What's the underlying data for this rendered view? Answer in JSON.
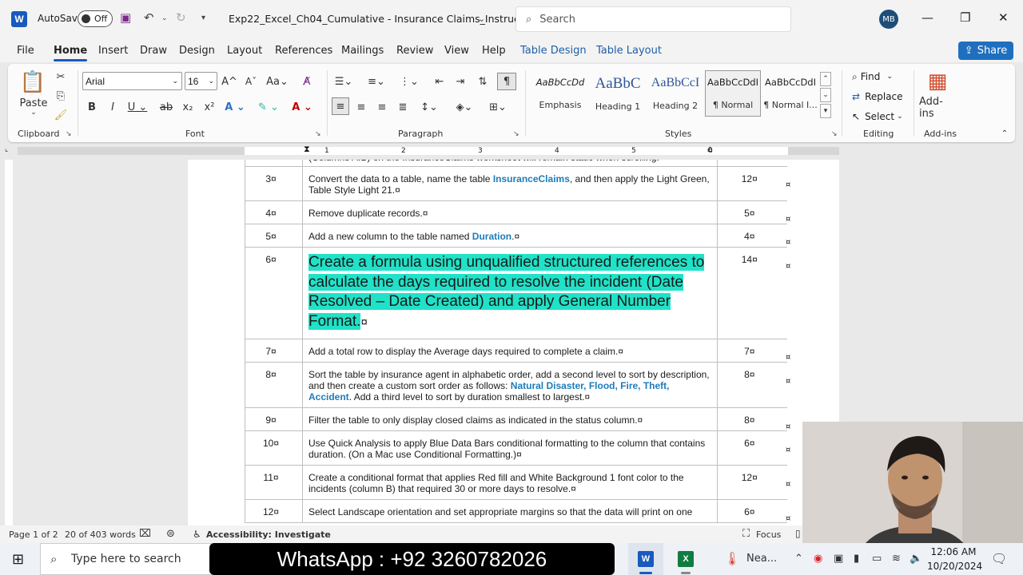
{
  "titlebar": {
    "logo": "W",
    "autosave_label": "AutoSave",
    "autosave_state": "Off",
    "doc_title": "Exp22_Excel_Ch04_Cumulative - Insurance Claims_Instruct...",
    "search_placeholder": "Search",
    "avatar": "MB"
  },
  "menu": {
    "file": "File",
    "home": "Home",
    "insert": "Insert",
    "draw": "Draw",
    "design": "Design",
    "layout": "Layout",
    "references": "References",
    "mailings": "Mailings",
    "review": "Review",
    "view": "View",
    "help": "Help",
    "table_design": "Table Design",
    "table_layout": "Table Layout",
    "share": "Share"
  },
  "ribbon": {
    "clipboard": {
      "paste": "Paste",
      "label": "Clipboard"
    },
    "font": {
      "name": "Arial",
      "size": "16",
      "label": "Font"
    },
    "paragraph": {
      "label": "Paragraph"
    },
    "styles": {
      "label": "Styles",
      "items": [
        {
          "preview": "AaBbCcDd",
          "name": "Emphasis"
        },
        {
          "preview": "AaBbC",
          "name": "Heading 1"
        },
        {
          "preview": "AaBbCcI",
          "name": "Heading 2"
        },
        {
          "preview": "AaBbCcDdI",
          "name": "¶ Normal"
        },
        {
          "preview": "AaBbCcDdI",
          "name": "¶ Normal I..."
        }
      ]
    },
    "editing": {
      "find": "Find",
      "replace": "Replace",
      "select": "Select",
      "label": "Editing"
    },
    "addins": {
      "button": "Add-ins",
      "label": "Add-ins"
    }
  },
  "ruler": {
    "ticks": [
      "1",
      "2",
      "3",
      "4",
      "5",
      "6"
    ]
  },
  "table": {
    "top_fragment": "(Columns A:B) on the InsuranceClaims worksheet will remain static when scrolling.",
    "end_mark": "¤",
    "rows": [
      {
        "num": "3¤",
        "pre": "Convert the data to a table, name the table ",
        "kw": "InsuranceClaims",
        "post": ", and then apply the Light Green, Table Style Light 21.¤",
        "pts": "12¤"
      },
      {
        "num": "4¤",
        "pre": "Remove duplicate records.¤",
        "kw": "",
        "post": "",
        "pts": "5¤"
      },
      {
        "num": "5¤",
        "pre": "Add a new column to the table named ",
        "kw": "Duration",
        "post": ".¤",
        "pts": "4¤"
      },
      {
        "num": "6¤",
        "highlight": "Create a formula using unqualified structured references to calculate the days required to resolve the incident (Date Resolved – Date Created) and apply General Number Format.",
        "mark": "¤",
        "pts": "14¤"
      },
      {
        "num": "7¤",
        "pre": "Add a total row to display the Average days required to complete a claim.¤",
        "kw": "",
        "post": "",
        "pts": "7¤"
      },
      {
        "num": "8¤",
        "pre": "Sort the table by insurance agent in alphabetic order, add a second level to sort by description, and then create a custom sort order as follows: ",
        "kw": "Natural Disaster, Flood, Fire, Theft, Accident",
        "post": ". Add a third level to sort by duration smallest to largest.¤",
        "pts": "8¤"
      },
      {
        "num": "9¤",
        "pre": "Filter the table to only display closed claims as indicated in the status column.¤",
        "kw": "",
        "post": "",
        "pts": "8¤"
      },
      {
        "num": "10¤",
        "pre": "Use Quick Analysis to apply Blue Data Bars conditional formatting to the column that contains duration. (On a Mac use Conditional Formatting.)¤",
        "kw": "",
        "post": "",
        "pts": "6¤"
      },
      {
        "num": "11¤",
        "pre": "Create a conditional format that applies Red fill and White Background 1 font color to the incidents (column B) that required 30 or more days to resolve.¤",
        "kw": "",
        "post": "",
        "pts": "12¤"
      },
      {
        "num": "12¤",
        "pre": "Select Landscape orientation and set appropriate margins so that the data will print on one",
        "kw": "",
        "post": "",
        "pts": "6¤"
      }
    ]
  },
  "status": {
    "page": "Page 1 of 2",
    "words": "20 of 403 words",
    "accessibility": "Accessibility: Investigate",
    "focus": "Focus"
  },
  "taskbar": {
    "search_placeholder": "Type here to search",
    "banner": "WhatsApp : +92 3260782026",
    "weather": "Nea...",
    "time": "12:06 AM",
    "date": "10/20/2024"
  },
  "colors": {
    "accent": "#185abd",
    "highlight": "#20e2c8",
    "keyword": "#1d7cba"
  }
}
